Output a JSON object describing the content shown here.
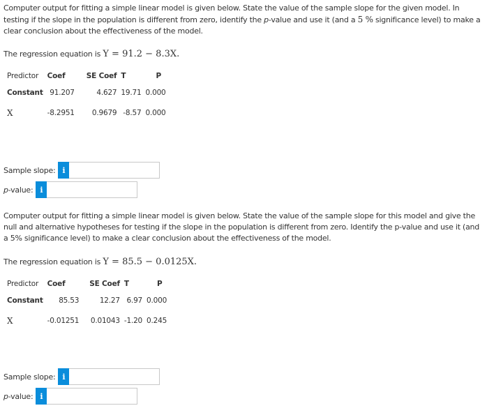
{
  "questions": [
    {
      "prompt_parts": {
        "part1": "Computer output for fitting a simple linear model is given below. State the value of the sample slope for the given model. In testing if the slope in the population is different from zero, identify the ",
        "p_italic": "p",
        "part2": "-value and use it (and a ",
        "significance": "5 %",
        "part3": " significance level) to make a clear conclusion about the effectiveness of the model."
      },
      "equation_label": "The regression equation is ",
      "equation": "Y = 91.2 − 8.3X.",
      "table": {
        "headers": [
          "Predictor",
          "Coef",
          "SE Coef",
          "T",
          "P"
        ],
        "rows": [
          {
            "predictor": "Constant",
            "coef": "91.207",
            "se_coef": "4.627",
            "t": "19.71",
            "p": "0.000"
          },
          {
            "predictor": "X",
            "coef": "-8.2951",
            "se_coef": "0.9679",
            "t": "-8.57",
            "p": "0.000"
          }
        ]
      },
      "answers": {
        "slope_label": "Sample slope:",
        "pvalue_label_italic": "p",
        "pvalue_label_rest": "-value:",
        "info_icon": "i",
        "slope_value": "",
        "pvalue_value": ""
      }
    },
    {
      "prompt_parts": {
        "part1": "Computer output for fitting a simple linear model is given below. State the value of the sample slope for this model and give the null and alternative hypotheses for testing if the slope in the population is different from zero. Identify the p-value and use it (and a 5% significance level) to make a clear conclusion about the effectiveness of the model."
      },
      "equation_label": "The regression equation is ",
      "equation": "Y = 85.5 − 0.0125X.",
      "table": {
        "headers": [
          "Predictor",
          "Coef",
          "SE Coef",
          "T",
          "P"
        ],
        "rows": [
          {
            "predictor": "Constant",
            "coef": "85.53",
            "se_coef": "12.27",
            "t": "6.97",
            "p": "0.000"
          },
          {
            "predictor": "X",
            "coef": "-0.01251",
            "se_coef": "0.01043",
            "t": "-1.20",
            "p": "0.245"
          }
        ]
      },
      "answers": {
        "slope_label": "Sample slope:",
        "pvalue_label_italic": "p",
        "pvalue_label_rest": "-value:",
        "info_icon": "i",
        "slope_value": "",
        "pvalue_value": ""
      }
    }
  ],
  "colors": {
    "info_button": "#0a8ddb",
    "input_border": "#c8c8c8",
    "text": "#333333"
  }
}
